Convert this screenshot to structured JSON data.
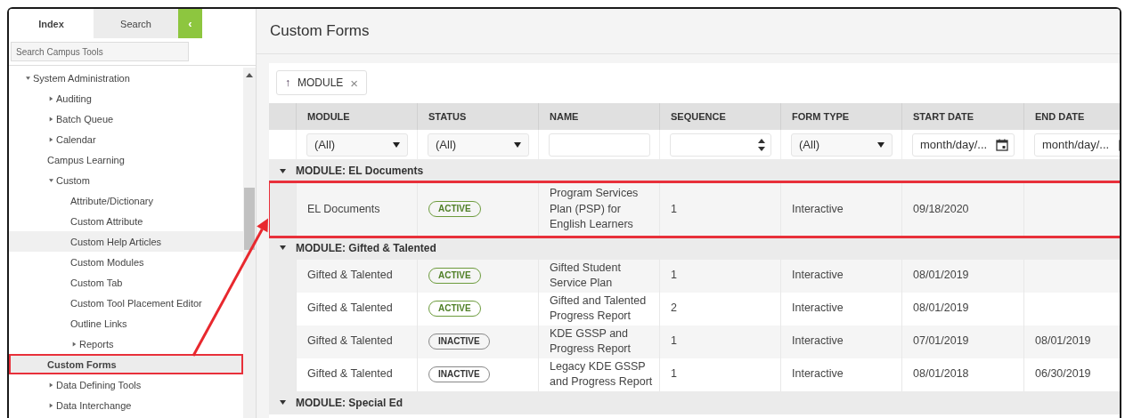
{
  "sidebar": {
    "tabs": [
      {
        "label": "Index",
        "selected": true
      },
      {
        "label": "Search",
        "selected": false
      }
    ],
    "collapse_button": "‹",
    "search": {
      "placeholder": "Search Campus Tools"
    },
    "tree": [
      {
        "label": "System Administration",
        "expanded": true,
        "selected": false,
        "hovered": false,
        "highlighted": false,
        "children": [
          {
            "label": "Auditing",
            "expanded": false,
            "selected": false,
            "hovered": false,
            "highlighted": false
          },
          {
            "label": "Batch Queue",
            "expanded": false,
            "selected": false,
            "hovered": false,
            "highlighted": false
          },
          {
            "label": "Calendar",
            "expanded": false,
            "selected": false,
            "hovered": false,
            "highlighted": false
          },
          {
            "label": "Campus Learning",
            "selected": false,
            "hovered": false,
            "highlighted": false
          },
          {
            "label": "Custom",
            "expanded": true,
            "selected": false,
            "hovered": false,
            "highlighted": false,
            "children": [
              {
                "label": "Attribute/Dictionary",
                "selected": false,
                "hovered": false,
                "highlighted": false
              },
              {
                "label": "Custom Attribute",
                "selected": false,
                "hovered": false,
                "highlighted": false
              },
              {
                "label": "Custom Help Articles",
                "selected": false,
                "hovered": true,
                "highlighted": false
              },
              {
                "label": "Custom Modules",
                "selected": false,
                "hovered": false,
                "highlighted": false
              },
              {
                "label": "Custom Tab",
                "selected": false,
                "hovered": false,
                "highlighted": false
              },
              {
                "label": "Custom Tool Placement Editor",
                "selected": false,
                "hovered": false,
                "highlighted": false
              },
              {
                "label": "Outline Links",
                "selected": false,
                "hovered": false,
                "highlighted": false
              },
              {
                "label": "Reports",
                "expanded": false,
                "selected": false,
                "hovered": false,
                "highlighted": false
              }
            ]
          },
          {
            "label": "Custom Forms",
            "selected": true,
            "hovered": false,
            "highlighted": true
          },
          {
            "label": "Data Defining Tools",
            "expanded": false,
            "selected": false,
            "hovered": false,
            "highlighted": false
          },
          {
            "label": "Data Interchange",
            "expanded": false,
            "selected": false,
            "hovered": false,
            "highlighted": false
          }
        ]
      }
    ]
  },
  "page": {
    "title": "Custom Forms"
  },
  "sort_chips": [
    {
      "arrow": "↑",
      "label": "MODULE",
      "remove": "×"
    }
  ],
  "table": {
    "columns": [
      {
        "label": "MODULE",
        "filter": {
          "kind": "select",
          "value": "(All)"
        }
      },
      {
        "label": "STATUS",
        "filter": {
          "kind": "select",
          "value": "(All)"
        }
      },
      {
        "label": "NAME",
        "filter": {
          "kind": "text"
        }
      },
      {
        "label": "SEQUENCE",
        "filter": {
          "kind": "number"
        }
      },
      {
        "label": "FORM TYPE",
        "filter": {
          "kind": "select",
          "value": "(All)"
        }
      },
      {
        "label": "START DATE",
        "filter": {
          "kind": "date",
          "placeholder": "month/day/..."
        }
      },
      {
        "label": "END DATE",
        "filter": {
          "kind": "date",
          "placeholder": "month/day/..."
        }
      }
    ],
    "groups": [
      {
        "label": "MODULE: EL Documents",
        "expanded": true,
        "rows": [
          {
            "module": "EL Documents",
            "status": {
              "label": "ACTIVE",
              "kind": "active"
            },
            "name": "Program Services Plan (PSP) for English Learners",
            "sequence": "1",
            "form_type": "Interactive",
            "start_date": "09/18/2020",
            "highlighted": true
          }
        ]
      },
      {
        "label": "MODULE: Gifted & Talented",
        "expanded": true,
        "rows": [
          {
            "module": "Gifted & Talented",
            "status": {
              "label": "ACTIVE",
              "kind": "active"
            },
            "name": "Gifted Student Service Plan",
            "sequence": "1",
            "form_type": "Interactive",
            "start_date": "08/01/2019",
            "highlighted": false
          },
          {
            "module": "Gifted & Talented",
            "status": {
              "label": "ACTIVE",
              "kind": "active"
            },
            "name": "Gifted and Talented Progress Report",
            "sequence": "2",
            "form_type": "Interactive",
            "start_date": "08/01/2019",
            "highlighted": false
          },
          {
            "module": "Gifted & Talented",
            "status": {
              "label": "INACTIVE",
              "kind": "inactive"
            },
            "name": "KDE GSSP and Progress Report",
            "sequence": "1",
            "form_type": "Interactive",
            "start_date": "07/01/2019",
            "end_date": "08/01/2019",
            "highlighted": false
          },
          {
            "module": "Gifted & Talented",
            "status": {
              "label": "INACTIVE",
              "kind": "inactive"
            },
            "name": "Legacy KDE GSSP and Progress Report",
            "sequence": "1",
            "form_type": "Interactive",
            "start_date": "08/01/2018",
            "end_date": "06/30/2019",
            "highlighted": false
          }
        ]
      },
      {
        "label": "MODULE: Special Ed",
        "expanded": true
      }
    ]
  }
}
